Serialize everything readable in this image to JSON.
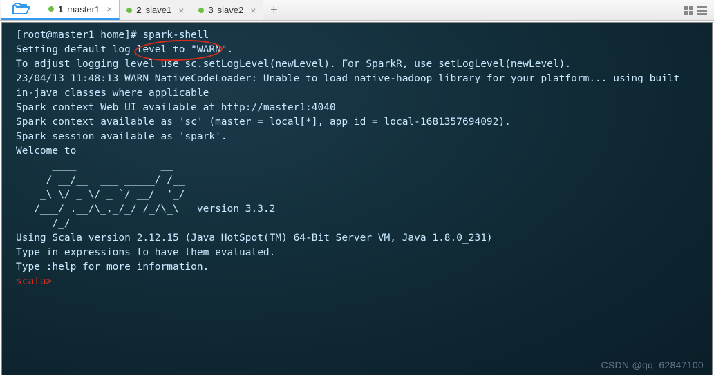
{
  "tabs": [
    {
      "num": "1",
      "label": "master1",
      "active": true
    },
    {
      "num": "2",
      "label": "slave1",
      "active": false
    },
    {
      "num": "3",
      "label": "slave2",
      "active": false
    }
  ],
  "close_glyph": "×",
  "add_glyph": "+",
  "term": {
    "l0": "[root@master1 home]# spark-shell",
    "l1": "Setting default log level to \"WARN\".",
    "l2": "To adjust logging level use sc.setLogLevel(newLevel). For SparkR, use setLogLevel(newLevel).",
    "l3": "23/04/13 11:48:13 WARN NativeCodeLoader: Unable to load native-hadoop library for your platform... using built",
    "l4": "in-java classes where applicable",
    "l5": "Spark context Web UI available at http://master1:4040",
    "l6": "Spark context available as 'sc' (master = local[*], app id = local-1681357694092).",
    "l7": "Spark session available as 'spark'.",
    "l8": "Welcome to",
    "a0": "      ____              __",
    "a1": "     / __/__  ___ _____/ /__",
    "a2": "    _\\ \\/ _ \\/ _ `/ __/  '_/",
    "a3": "   /___/ .__/\\_,_/_/ /_/\\_\\   version 3.3.2",
    "a4": "      /_/",
    "l9": "",
    "l10": "Using Scala version 2.12.15 (Java HotSpot(TM) 64-Bit Server VM, Java 1.8.0_231)",
    "l11": "Type in expressions to have them evaluated.",
    "l12": "Type :help for more information.",
    "l13": "",
    "prompt": "scala> "
  },
  "watermark": "CSDN @qq_62847100"
}
